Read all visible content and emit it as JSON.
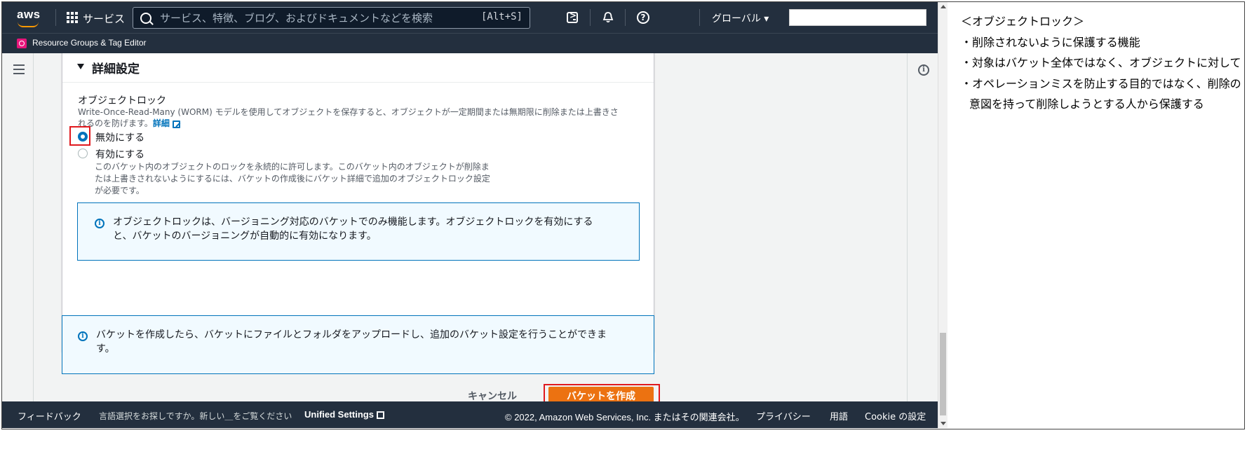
{
  "topnav": {
    "logo": "aws",
    "services": "サービス",
    "search_placeholder": "サービス、特徴、ブログ、およびドキュメントなどを検索",
    "search_shortcut": "[Alt+S]",
    "region": "グローバル ▾",
    "help": "?"
  },
  "subnav": {
    "label": "Resource Groups & Tag Editor"
  },
  "panel": {
    "title": "詳細設定",
    "object_lock_label": "オブジェクトロック",
    "object_lock_desc_1": "Write-Once-Read-Many (WORM) モデルを使用してオブジェクトを保存すると、オブジェクトが一定期間または無期限に削除または上書きさ",
    "object_lock_desc_2": "れるのを防げます。",
    "details_link": "詳細",
    "radio_disable": "無効にする",
    "radio_enable": "有効にする",
    "enable_desc": "このバケット内のオブジェクトのロックを永続的に許可します。このバケット内のオブジェクトが削除または上書きされないようにするには、バケットの作成後にバケット詳細で追加のオブジェクトロック設定が必要です。",
    "alert_line_1": "オブジェクトロックは、バージョニング対応のバケットでのみ機能します。オブジェクトロックを有効にする",
    "alert_line_2": "と、バケットのバージョニングが自動的に有効になります。"
  },
  "info_alert": {
    "line_1": "バケットを作成したら、バケットにファイルとフォルダをアップロードし、追加のバケット設定を行うことができま",
    "line_2": "す。"
  },
  "actions": {
    "cancel": "キャンセル",
    "create": "バケットを作成"
  },
  "footer": {
    "feedback": "フィードバック",
    "language_prompt": "言語選択をお探しですか。新しい＿をご覧ください",
    "unified_settings": "Unified Settings",
    "copyright": "© 2022, Amazon Web Services, Inc. またはその関連会社。",
    "privacy": "プライバシー",
    "terms": "用語",
    "cookie": "Cookie の設定"
  },
  "notes": {
    "title": "＜オブジェクトロック＞",
    "line_1": "・削除されないように保護する機能",
    "line_2": "・対象はバケット全体ではなく、オブジェクトに対して",
    "line_3": "・オペレーションミスを防止する目的ではなく、削除の",
    "line_4": "意図を持って削除しようとする人から保護する"
  },
  "colors": {
    "nav_bg": "#232f3e",
    "primary_button": "#ec7211",
    "link": "#0073bb",
    "highlight": "#e0191e"
  }
}
